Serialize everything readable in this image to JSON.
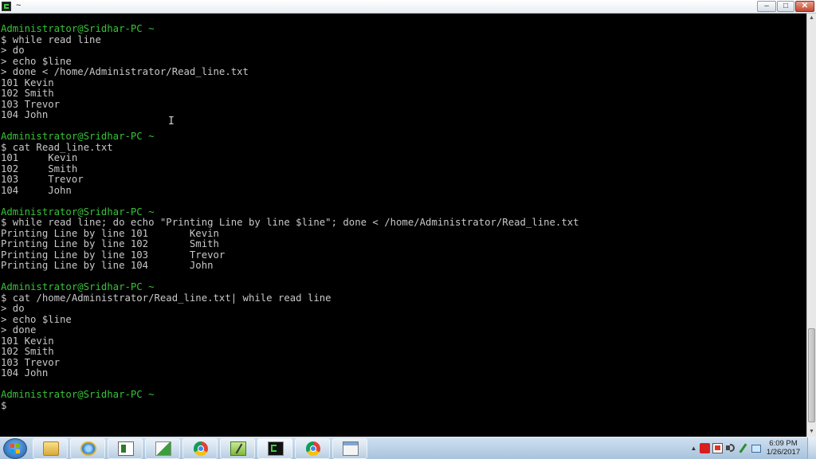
{
  "window": {
    "title": "~",
    "controls": {
      "minimize": "–",
      "maximize": "□",
      "close": "✕"
    },
    "icon": "cygwin-terminal-icon"
  },
  "terminal": {
    "lines": [
      {
        "kind": "prompt",
        "text": "Administrator@Sridhar-PC ~"
      },
      {
        "kind": "cmd",
        "text": "$ while read line"
      },
      {
        "kind": "cmd",
        "text": "> do"
      },
      {
        "kind": "cmd",
        "text": "> echo $line"
      },
      {
        "kind": "cmd",
        "text": "> done < /home/Administrator/Read_line.txt"
      },
      {
        "kind": "output",
        "text": "101 Kevin"
      },
      {
        "kind": "output",
        "text": "102 Smith"
      },
      {
        "kind": "output",
        "text": "103 Trevor"
      },
      {
        "kind": "output",
        "text": "104 John"
      },
      {
        "kind": "blank",
        "text": ""
      },
      {
        "kind": "prompt",
        "text": "Administrator@Sridhar-PC ~"
      },
      {
        "kind": "cmd",
        "text": "$ cat Read_line.txt"
      },
      {
        "kind": "output",
        "text": "101     Kevin"
      },
      {
        "kind": "output",
        "text": "102     Smith"
      },
      {
        "kind": "output",
        "text": "103     Trevor"
      },
      {
        "kind": "output",
        "text": "104     John"
      },
      {
        "kind": "blank",
        "text": ""
      },
      {
        "kind": "prompt",
        "text": "Administrator@Sridhar-PC ~"
      },
      {
        "kind": "cmd",
        "text": "$ while read line; do echo \"Printing Line by line $line\"; done < /home/Administrator/Read_line.txt"
      },
      {
        "kind": "output",
        "text": "Printing Line by line 101       Kevin"
      },
      {
        "kind": "output",
        "text": "Printing Line by line 102       Smith"
      },
      {
        "kind": "output",
        "text": "Printing Line by line 103       Trevor"
      },
      {
        "kind": "output",
        "text": "Printing Line by line 104       John"
      },
      {
        "kind": "blank",
        "text": ""
      },
      {
        "kind": "prompt",
        "text": "Administrator@Sridhar-PC ~"
      },
      {
        "kind": "cmd",
        "text": "$ cat /home/Administrator/Read_line.txt| while read line"
      },
      {
        "kind": "cmd",
        "text": "> do"
      },
      {
        "kind": "cmd",
        "text": "> echo $line"
      },
      {
        "kind": "cmd",
        "text": "> done"
      },
      {
        "kind": "output",
        "text": "101 Kevin"
      },
      {
        "kind": "output",
        "text": "102 Smith"
      },
      {
        "kind": "output",
        "text": "103 Trevor"
      },
      {
        "kind": "output",
        "text": "104 John"
      },
      {
        "kind": "blank",
        "text": ""
      },
      {
        "kind": "prompt",
        "text": "Administrator@Sridhar-PC ~"
      },
      {
        "kind": "cmd",
        "text": "$"
      }
    ],
    "mouse_cursor": "I",
    "colors": {
      "background": "#000000",
      "text": "#c8c8c8",
      "prompt": "#38c338"
    }
  },
  "scrollbar": {
    "up_arrow": "▲",
    "down_arrow": "▼"
  },
  "taskbar": {
    "start": "windows-start-icon",
    "pinned": [
      {
        "name": "file-explorer",
        "icon": "folder-icon"
      },
      {
        "name": "internet-explorer",
        "icon": "ie-icon"
      },
      {
        "name": "calculator",
        "icon": "calculator-icon"
      },
      {
        "name": "file-share",
        "icon": "share-icon"
      },
      {
        "name": "chrome",
        "icon": "chrome-icon"
      },
      {
        "name": "notepad-plus",
        "icon": "notepad-icon"
      },
      {
        "name": "cygwin-terminal",
        "icon": "terminal-icon"
      },
      {
        "name": "chrome-2",
        "icon": "chrome-icon"
      },
      {
        "name": "window",
        "icon": "window-icon"
      }
    ],
    "tray": {
      "expand": "▲"
    },
    "clock": {
      "time": "6:09 PM",
      "date": "1/26/2017"
    }
  }
}
